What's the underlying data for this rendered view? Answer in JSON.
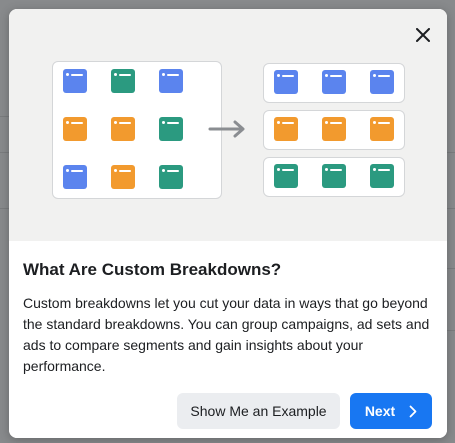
{
  "modal": {
    "title": "What Are Custom Breakdowns?",
    "description": "Custom breakdowns let you cut your data in ways that go beyond the standard breakdowns. You can group campaigns, ad sets and ads to compare segments and gain insights about your performance.",
    "secondary_button": "Show Me an Example",
    "primary_button": "Next",
    "close_icon": "close-icon",
    "next_icon": "chevron-right-icon"
  },
  "illustration": {
    "grid_tiles": [
      [
        "blue",
        "green",
        "blue"
      ],
      [
        "orange",
        "orange",
        "green"
      ],
      [
        "blue",
        "orange",
        "green"
      ]
    ],
    "grouped_rows": [
      [
        "blue",
        "blue",
        "blue"
      ],
      [
        "orange",
        "orange",
        "orange"
      ],
      [
        "green",
        "green",
        "green"
      ]
    ],
    "arrow_icon": "arrow-right-icon"
  },
  "colors": {
    "blue": "#5b84ee",
    "green": "#2b9a80",
    "orange": "#f29a2e",
    "primary": "#1877f2"
  }
}
